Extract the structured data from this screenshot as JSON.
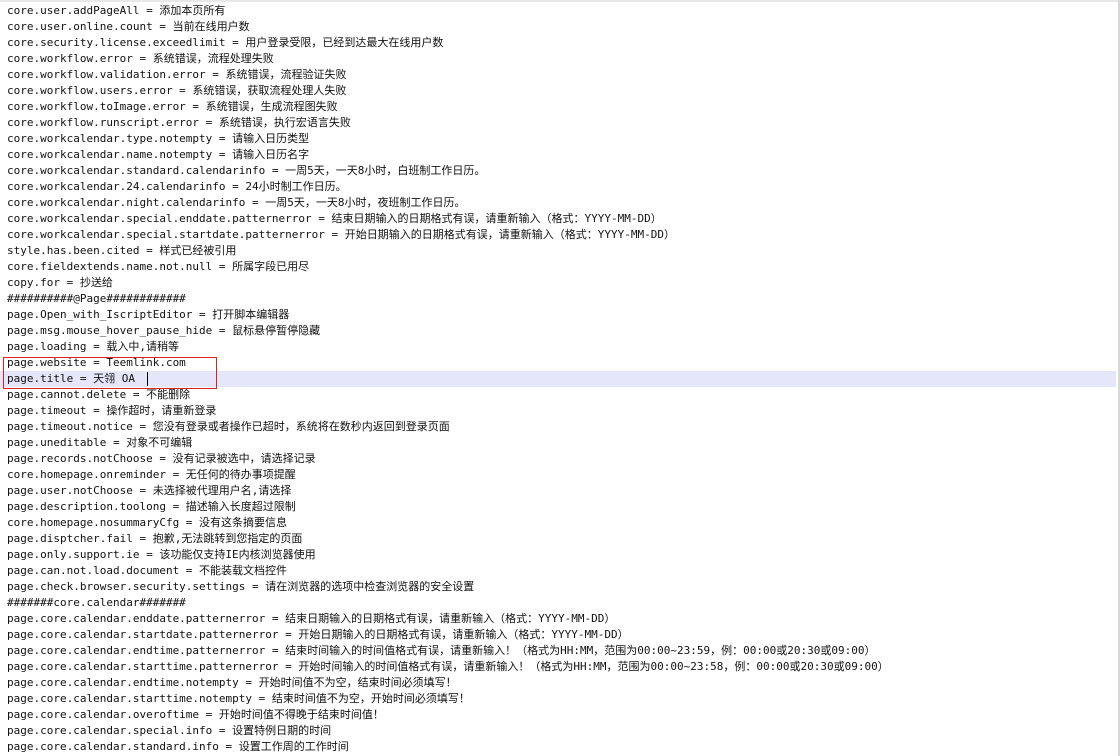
{
  "editor": {
    "lines": [
      "core.user.addPageAll = 添加本页所有",
      "core.user.online.count = 当前在线用户数",
      "core.security.license.exceedlimit = 用户登录受限，已经到达最大在线用户数",
      "core.workflow.error = 系统错误，流程处理失败",
      "core.workflow.validation.error = 系统错误，流程验证失败",
      "core.workflow.users.error = 系统错误，获取流程处理人失败",
      "core.workflow.toImage.error = 系统错误，生成流程图失败",
      "core.workflow.runscript.error = 系统错误，执行宏语言失败",
      "core.workcalendar.type.notempty = 请输入日历类型",
      "core.workcalendar.name.notempty = 请输入日历名字",
      "core.workcalendar.standard.calendarinfo = 一周5天，一天8小时，白班制工作日历。",
      "core.workcalendar.24.calendarinfo = 24小时制工作日历。",
      "core.workcalendar.night.calendarinfo = 一周5天，一天8小时，夜班制工作日历。",
      "core.workcalendar.special.enddate.patternerror = 结束日期输入的日期格式有误，请重新输入（格式：YYYY-MM-DD）",
      "core.workcalendar.special.startdate.patternerror = 开始日期输入的日期格式有误，请重新输入（格式：YYYY-MM-DD）",
      "style.has.been.cited = 样式已经被引用",
      "core.fieldextends.name.not.null = 所属字段已用尽",
      "copy.for = 抄送给",
      "##########@Page############",
      "page.Open_with_IscriptEditor = 打开脚本编辑器",
      "page.msg.mouse_hover_pause_hide = 鼠标悬停暂停隐藏",
      "page.loading = 载入中,请稍等",
      "page.website = Teemlink.com",
      "page.title = 天翎 OA",
      "page.cannot.delete = 不能删除",
      "page.timeout = 操作超时，请重新登录",
      "page.timeout.notice = 您没有登录或者操作已超时，系统将在数秒内返回到登录页面",
      "page.uneditable = 对象不可编辑",
      "page.records.notChoose = 没有记录被选中，请选择记录",
      "core.homepage.onreminder = 无任何的待办事项提醒",
      "page.user.notChoose = 未选择被代理用户名,请选择",
      "page.description.toolong = 描述输入长度超过限制",
      "core.homepage.nosummaryCfg = 没有这条摘要信息",
      "page.disptcher.fail = 抱歉,无法跳转到您指定的页面",
      "page.only.support.ie = 该功能仅支持IE内核浏览器使用",
      "page.can.not.load.document = 不能装载文档控件",
      "page.check.browser.security.settings = 请在浏览器的选项中检查浏览器的安全设置",
      "#######core.calendar#######",
      "page.core.calendar.enddate.patternerror = 结束日期输入的日期格式有误，请重新输入（格式：YYYY-MM-DD）",
      "page.core.calendar.startdate.patternerror = 开始日期输入的日期格式有误，请重新输入（格式：YYYY-MM-DD）",
      "page.core.calendar.endtime.patternerror = 结束时间输入的时间值格式有误，请重新输入！（格式为HH:MM，范围为00:00~23:59，例：00:00或20:30或09:00）",
      "page.core.calendar.starttime.patternerror = 开始时间输入的时间值格式有误，请重新输入！（格式为HH:MM，范围为00:00~23:58，例：00:00或20:30或09:00）",
      "page.core.calendar.endtime.notempty = 开始时间值不为空，结束时间必须填写！",
      "page.core.calendar.starttime.notempty = 结束时间值不为空，开始时间必须填写！",
      "page.core.calendar.overoftime = 开始时间值不得晚于结束时间值！",
      "page.core.calendar.special.info = 设置特例日期的时间",
      "page.core.calendar.standard.info = 设置工作周的工作时间"
    ]
  }
}
